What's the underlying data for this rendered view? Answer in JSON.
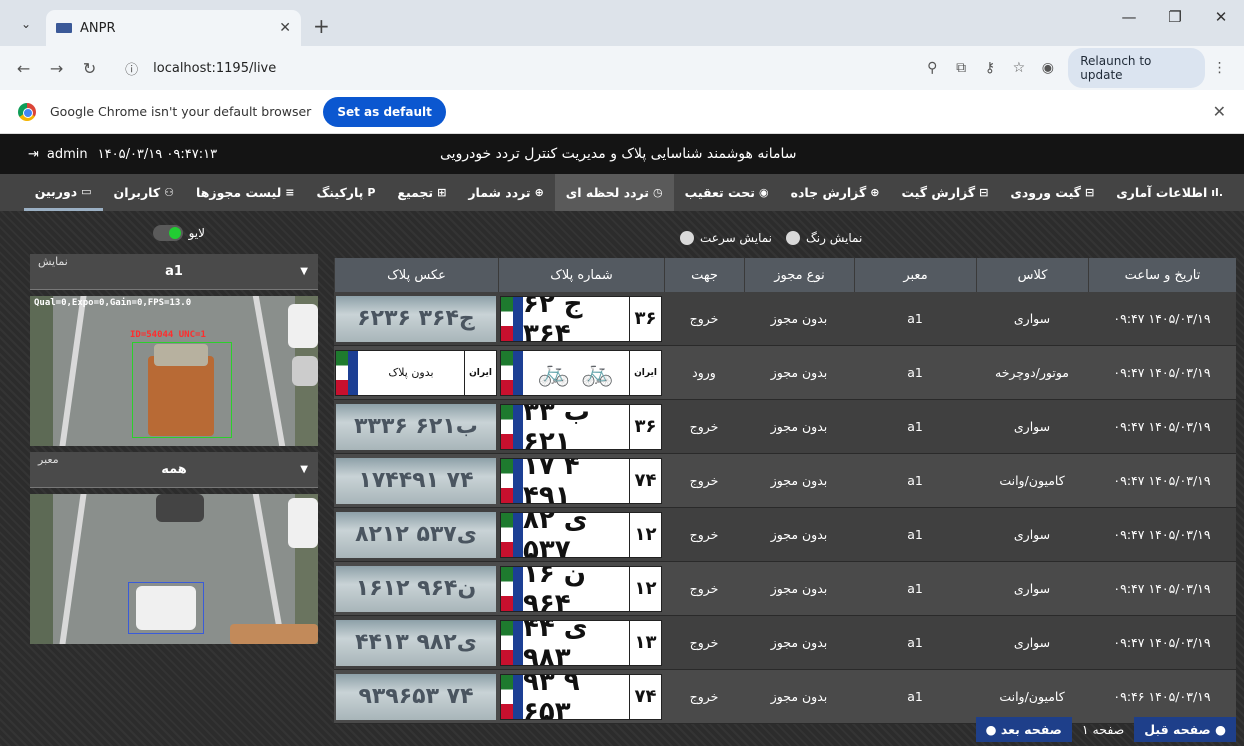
{
  "browser": {
    "tab_title": "ANPR",
    "url": "localhost:1195/live",
    "relaunch_label": "Relaunch to update",
    "infobar_text": "Google Chrome isn't your default browser",
    "set_default_label": "Set as default"
  },
  "header": {
    "user": "admin",
    "datetime": "۱۴۰۵/۰۳/۱۹ ۰۹:۴۷:۱۳",
    "title": "سامانه هوشمند شناسایی پلاک و مدیریت کنترل تردد خودرویی"
  },
  "nav": [
    {
      "label": "اطلاعات آماری",
      "icon": "bar-chart-icon",
      "glyph": ".ıl"
    },
    {
      "label": "گیت ورودی",
      "icon": "gate-in-icon",
      "glyph": "⊟"
    },
    {
      "label": "گزارش گیت",
      "icon": "gate-report-icon",
      "glyph": "⊟"
    },
    {
      "label": "گزارش جاده",
      "icon": "road-report-icon",
      "glyph": "⊕"
    },
    {
      "label": "تحت تعقیب",
      "icon": "shield-icon",
      "glyph": "◉"
    },
    {
      "label": "تردد لحظه ای",
      "icon": "clock-icon",
      "glyph": "◷"
    },
    {
      "label": "تردد شمار",
      "icon": "counter-icon",
      "glyph": "⊕"
    },
    {
      "label": "تجمیع",
      "icon": "grid-icon",
      "glyph": "⊞"
    },
    {
      "label": "پارکینگ",
      "icon": "parking-icon",
      "glyph": "P"
    },
    {
      "label": "لیست مجوزها",
      "icon": "list-icon",
      "glyph": "≡"
    },
    {
      "label": "کاربران",
      "icon": "users-icon",
      "glyph": "⚇"
    },
    {
      "label": "دوربین",
      "icon": "camera-icon",
      "glyph": "▭"
    }
  ],
  "left": {
    "live_label": "لایو",
    "display_label": "نمایش",
    "display_value": "a1",
    "gate_label": "معبر",
    "gate_value": "همه",
    "cam1_overlay": "Qual=0,Expo=0,Gain=0,FPS=13.0",
    "cam1_detect": "ID=54044 UNC=1"
  },
  "switches": {
    "color": "نمایش رنگ",
    "speed": "نمایش سرعت"
  },
  "table": {
    "headers": {
      "datetime": "تاریخ و ساعت",
      "class": "کلاس",
      "gate": "معبر",
      "permit_type": "نوع مجوز",
      "direction": "جهت",
      "plate_number": "شماره پلاک",
      "plate_photo": "عکس پلاک"
    },
    "rows": [
      {
        "datetime": "۰۹:۴۷ ۱۴۰۵/۰۳/۱۹",
        "class": "سواری",
        "gate": "a1",
        "permit": "بدون مجوز",
        "direction": "خروج",
        "plate_num": "۶۲ ج ۳۶۴",
        "plate_reg": "۳۶",
        "photo": "۶۲ج۳۶۴ ۳۶"
      },
      {
        "datetime": "۰۹:۴۷ ۱۴۰۵/۰۳/۱۹",
        "class": "موتور/دوچرخه",
        "gate": "a1",
        "permit": "بدون مجوز",
        "direction": "ورود",
        "plate_num": "🚲 🚲",
        "plate_reg": "ایران",
        "photo": "بدون پلاک"
      },
      {
        "datetime": "۰۹:۴۷ ۱۴۰۵/۰۳/۱۹",
        "class": "سواری",
        "gate": "a1",
        "permit": "بدون مجوز",
        "direction": "خروج",
        "plate_num": "۳۳ ب ۶۲۱",
        "plate_reg": "۳۶",
        "photo": "۳۳ب۶۲۱ ۳۶"
      },
      {
        "datetime": "۰۹:۴۷ ۱۴۰۵/۰۳/۱۹",
        "class": "کامیون/وانت",
        "gate": "a1",
        "permit": "بدون مجوز",
        "direction": "خروج",
        "plate_num": "۱۷ ۴ ۴۹۱",
        "plate_reg": "۷۴",
        "photo": "۱۷۴۴۹۱ ۷۴"
      },
      {
        "datetime": "۰۹:۴۷ ۱۴۰۵/۰۳/۱۹",
        "class": "سواری",
        "gate": "a1",
        "permit": "بدون مجوز",
        "direction": "خروج",
        "plate_num": "۸۲ ی ۵۳۷",
        "plate_reg": "۱۲",
        "photo": "۸۲ی۵۳۷ ۱۲"
      },
      {
        "datetime": "۰۹:۴۷ ۱۴۰۵/۰۳/۱۹",
        "class": "سواری",
        "gate": "a1",
        "permit": "بدون مجوز",
        "direction": "خروج",
        "plate_num": "۱۶ ن ۹۶۴",
        "plate_reg": "۱۲",
        "photo": "۱۶ن۹۶۴ ۱۲"
      },
      {
        "datetime": "۰۹:۴۷ ۱۴۰۵/۰۳/۱۹",
        "class": "سواری",
        "gate": "a1",
        "permit": "بدون مجوز",
        "direction": "خروج",
        "plate_num": "۴۴ ی ۹۸۳",
        "plate_reg": "۱۳",
        "photo": "۴۴ی۹۸۲ ۱۳"
      },
      {
        "datetime": "۰۹:۴۶ ۱۴۰۵/۰۳/۱۹",
        "class": "کامیون/وانت",
        "gate": "a1",
        "permit": "بدون مجوز",
        "direction": "خروج",
        "plate_num": "۹۳ ۹ ۶۵۳",
        "plate_reg": "۷۴",
        "photo": "۹۳۹۶۵۳ ۷۴"
      }
    ]
  },
  "pager": {
    "prev": "صفحه قبل",
    "page": "صفحه ۱",
    "next": "صفحه بعد"
  }
}
